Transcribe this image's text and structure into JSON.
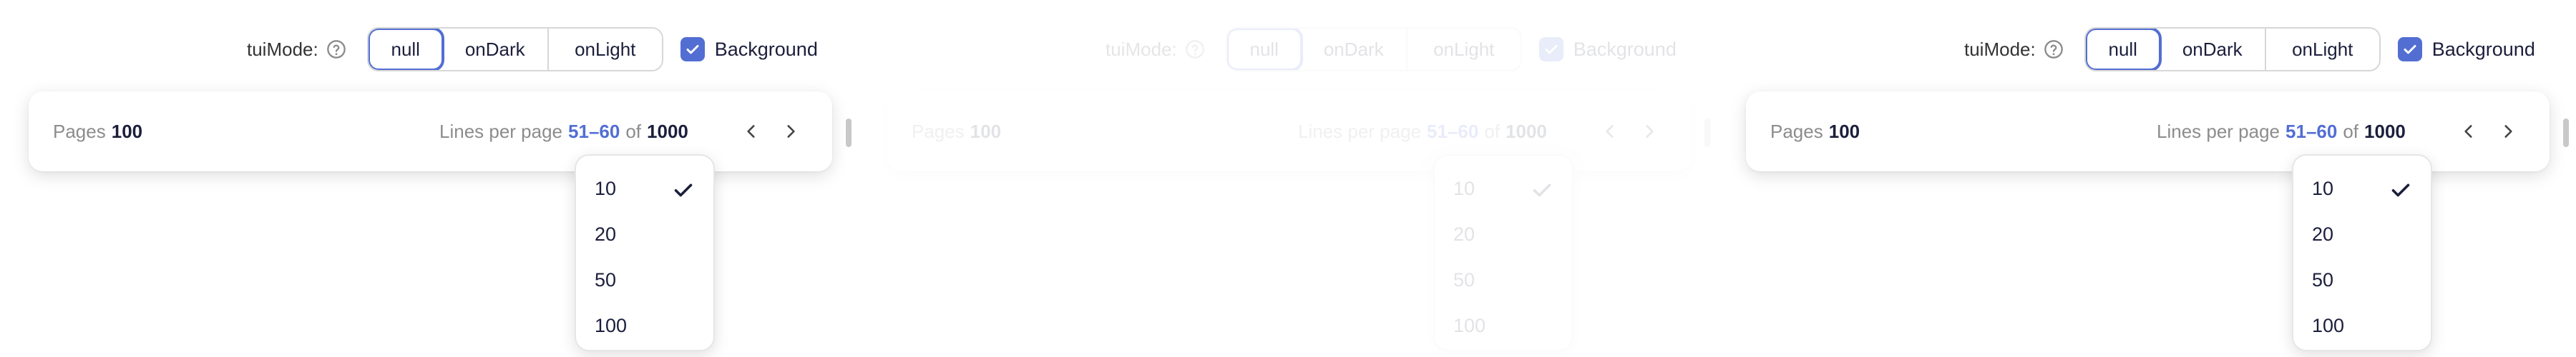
{
  "panels": [
    {
      "controls": {
        "mode_label": "tuiMode:",
        "modes": [
          "null",
          "onDark",
          "onLight"
        ],
        "active_mode": "null",
        "background_label": "Background",
        "background_checked": true
      },
      "pagination": {
        "pages_label": "Pages",
        "pages_count": "100",
        "lines_label": "Lines per page",
        "range": "51–60",
        "of_label": "of",
        "total": "1000"
      },
      "dropdown": {
        "options": [
          "10",
          "20",
          "50",
          "100"
        ],
        "selected": "10"
      }
    },
    {
      "controls": {
        "mode_label": "tuiMode:",
        "modes": [
          "null",
          "onDark",
          "onLight"
        ],
        "active_mode": "null",
        "background_label": "Background",
        "background_checked": true
      },
      "pagination": {
        "pages_label": "Pages",
        "pages_count": "100",
        "lines_label": "Lines per page",
        "range": "51–60",
        "of_label": "of",
        "total": "1000"
      },
      "dropdown": {
        "options": [
          "10",
          "20",
          "50",
          "100"
        ],
        "selected": "10"
      }
    },
    {
      "controls": {
        "mode_label": "tuiMode:",
        "modes": [
          "null",
          "onDark",
          "onLight"
        ],
        "active_mode": "null",
        "background_label": "Background",
        "background_checked": true
      },
      "pagination": {
        "pages_label": "Pages",
        "pages_count": "100",
        "lines_label": "Lines per page",
        "range": "51–60",
        "of_label": "of",
        "total": "1000"
      },
      "dropdown": {
        "options": [
          "10",
          "20",
          "50",
          "100"
        ],
        "selected": "10"
      }
    }
  ],
  "colors": {
    "accent": "#526ed3",
    "text": "#1b1f3b",
    "muted": "#8c8c8c",
    "border": "#d7d7d7"
  },
  "icons": {
    "help": "question-circle-icon",
    "check": "checkmark-icon",
    "prev": "chevron-left-icon",
    "next": "chevron-right-icon"
  }
}
